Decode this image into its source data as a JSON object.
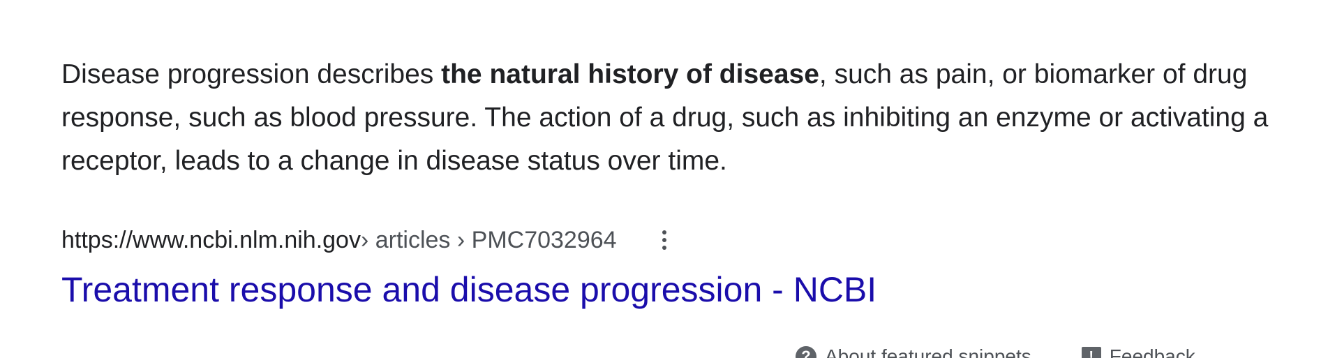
{
  "snippet": {
    "text_before": "Disease progression describes ",
    "bold_text": "the natural history of disease",
    "text_after": ", such as pain, or biomarker of drug response, such as blood pressure. The action of a drug, such as inhibiting an enzyme or activating a receptor, leads to a change in disease status over time."
  },
  "citation": {
    "domain": "https://www.ncbi.nlm.nih.gov",
    "path": " › articles › PMC7032964",
    "more_icon": "more-vert-icon"
  },
  "result": {
    "title": "Treatment response and disease progression - NCBI",
    "link_color": "#1a0dab"
  },
  "footer": {
    "about_label": "About featured snippets",
    "about_icon": "help-icon",
    "feedback_label": "Feedback",
    "feedback_icon": "feedback-icon"
  }
}
